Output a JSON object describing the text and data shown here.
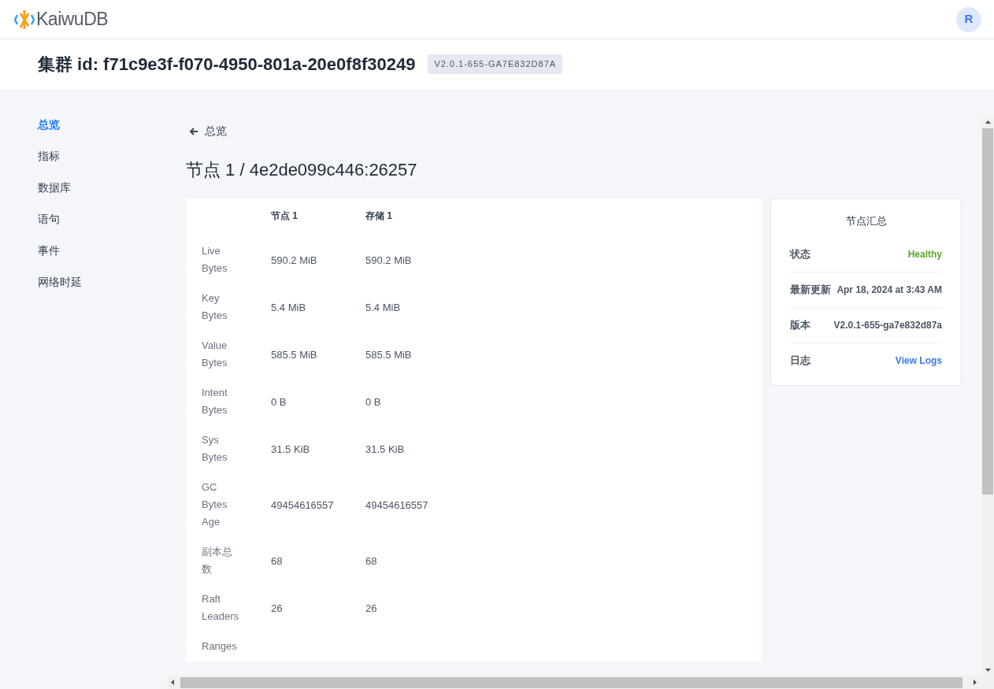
{
  "header": {
    "logo_text": "KaiwuDB",
    "avatar": "R"
  },
  "cluster": {
    "title": "集群 id: f71c9e3f-f070-4950-801a-20e0f8f30249",
    "version_badge": "V2.0.1-655-GA7E832D87A"
  },
  "sidebar": {
    "items": [
      {
        "label": "总览",
        "selected": true
      },
      {
        "label": "指标",
        "selected": false
      },
      {
        "label": "数据库",
        "selected": false
      },
      {
        "label": "语句",
        "selected": false
      },
      {
        "label": "事件",
        "selected": false
      },
      {
        "label": "网络时延",
        "selected": false
      }
    ]
  },
  "back_link": "总览",
  "page_title": "节点 1 / 4e2de099c446:26257",
  "table": {
    "columns": [
      "节点 1",
      "存储 1"
    ],
    "rows": [
      {
        "label": "Live Bytes",
        "values": [
          "590.2 MiB",
          "590.2 MiB"
        ]
      },
      {
        "label": "Key Bytes",
        "values": [
          "5.4 MiB",
          "5.4 MiB"
        ]
      },
      {
        "label": "Value Bytes",
        "values": [
          "585.5 MiB",
          "585.5 MiB"
        ]
      },
      {
        "label": "Intent Bytes",
        "values": [
          "0 B",
          "0 B"
        ]
      },
      {
        "label": "Sys Bytes",
        "values": [
          "31.5 KiB",
          "31.5 KiB"
        ]
      },
      {
        "label": "GC Bytes Age",
        "values": [
          "49454616557",
          "49454616557"
        ]
      },
      {
        "label": "副本总数",
        "values": [
          "68",
          "68"
        ]
      },
      {
        "label": "Raft Leaders",
        "values": [
          "26",
          "26"
        ]
      },
      {
        "label": "Ranges",
        "values": []
      }
    ]
  },
  "summary": {
    "title": "节点汇总",
    "rows": [
      {
        "kind": "status",
        "label": "状态",
        "value": "Healthy"
      },
      {
        "kind": "text",
        "label": "最新更新",
        "value": "Apr 18, 2024 at 3:43 AM"
      },
      {
        "kind": "text",
        "label": "版本",
        "value": "V2.0.1-655-ga7e832d87a"
      },
      {
        "kind": "link",
        "label": "日志",
        "value": "View Logs"
      }
    ]
  }
}
